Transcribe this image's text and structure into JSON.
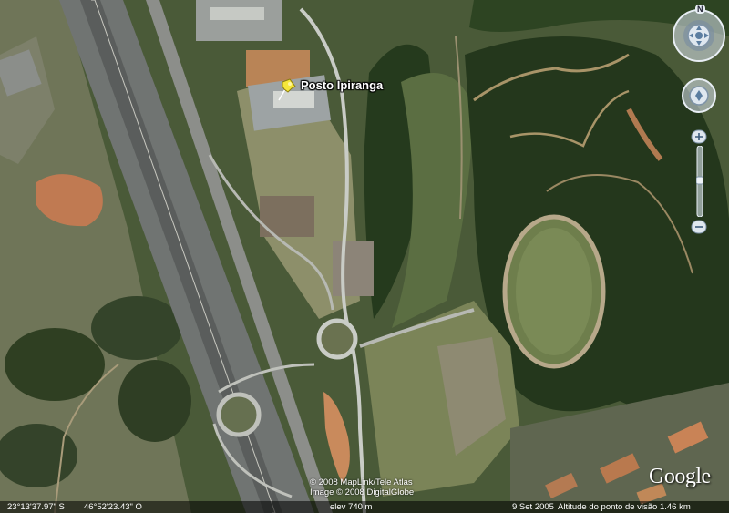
{
  "map": {
    "placemark_label": "Posto Ipiranga",
    "credits_line1": "© 2008 MapLink/Tele Atlas",
    "credits_line2": "Image © 2008 DigitalGlobe",
    "logo": "Google"
  },
  "statusbar": {
    "latitude": "23°13'37.97\" S",
    "longitude": "46°52'23.43\" O",
    "elevation": "elev  740 m",
    "date": "9 Set 2005",
    "eye_altitude": "Altitude do ponto de visão   1.46 km"
  },
  "navigation": {
    "north_label": "N",
    "icons": [
      "compass-ring-icon",
      "look-joystick-icon",
      "move-joystick-icon",
      "zoom-in-icon",
      "zoom-slider-icon",
      "zoom-out-icon"
    ]
  }
}
